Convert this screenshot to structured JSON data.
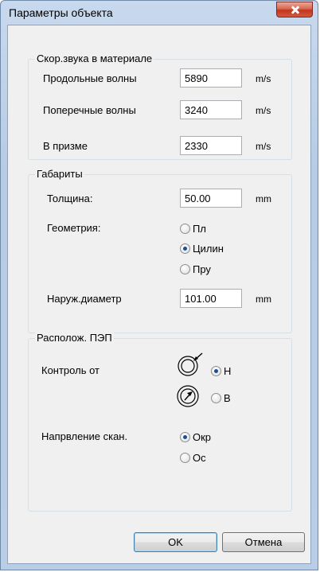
{
  "window": {
    "title": "Параметры объекта"
  },
  "speed_group": {
    "title": "Скор.звука в материале",
    "rows": [
      {
        "label": "Продольные волны",
        "value": "5890",
        "unit": "m/s"
      },
      {
        "label": "Поперечные волны",
        "value": "3240",
        "unit": "m/s"
      },
      {
        "label": "В призме",
        "value": "2330",
        "unit": "m/s"
      }
    ]
  },
  "dims_group": {
    "title": "Габариты",
    "thickness_label": "Толщина:",
    "thickness_value": "50.00",
    "thickness_unit": "mm",
    "geometry_label": "Геометрия:",
    "geometry_options": [
      {
        "label": "Пл",
        "checked": false
      },
      {
        "label": "Цилин",
        "checked": true
      },
      {
        "label": "Пру",
        "checked": false
      }
    ],
    "outer_diam_label": "Наруж.диаметр",
    "outer_diam_value": "101.00",
    "outer_diam_unit": "mm"
  },
  "probe_group": {
    "title": "Располож. ПЭП",
    "control_label": "Контроль от",
    "control_options": [
      {
        "label": "Н",
        "checked": true,
        "icon": "outer-surface-icon"
      },
      {
        "label": "В",
        "checked": false,
        "icon": "inner-surface-icon"
      }
    ],
    "scan_label": "Напрвление скан.",
    "scan_options": [
      {
        "label": "Окр",
        "checked": true
      },
      {
        "label": "Ос",
        "checked": false
      }
    ]
  },
  "buttons": {
    "ok": "OK",
    "cancel": "Отмена"
  }
}
